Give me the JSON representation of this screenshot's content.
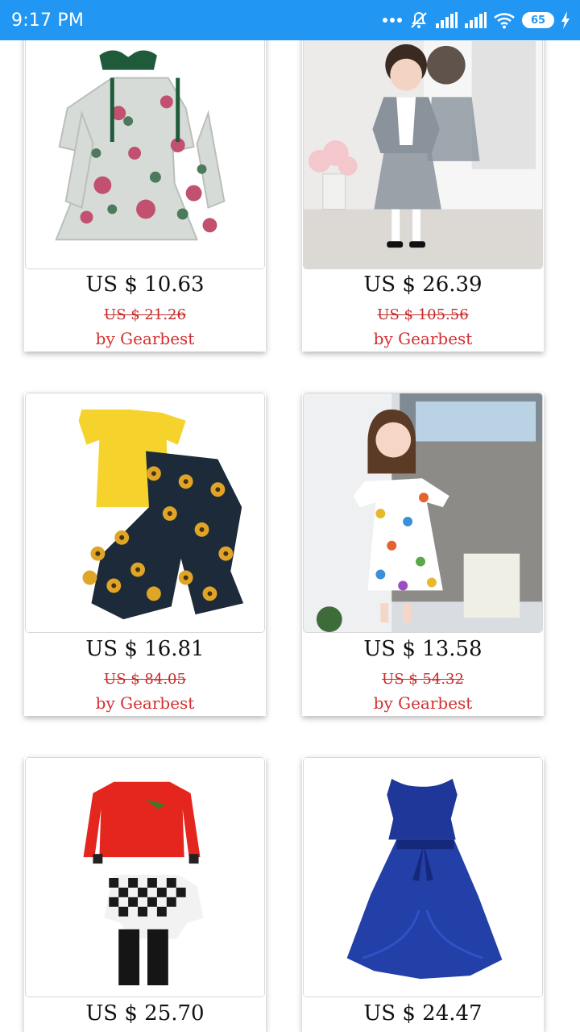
{
  "status_bar": {
    "time": "9:17 PM",
    "battery_level": "65",
    "icons": [
      "dots-icon",
      "dnd-off-icon",
      "signal-icon",
      "signal-icon",
      "wifi-icon",
      "battery-icon",
      "charging-icon"
    ]
  },
  "products": [
    {
      "price": "US $ 10.63",
      "old_price": "US $ 21.26",
      "seller": "by Gearbest",
      "image": "floral-dress-with-headband"
    },
    {
      "price": "US $ 26.39",
      "old_price": "US $ 105.56",
      "seller": "by Gearbest",
      "image": "girl-school-uniform"
    },
    {
      "price": "US $ 16.81",
      "old_price": "US $ 84.05",
      "seller": "by Gearbest",
      "image": "yellow-top-sunflower-pants"
    },
    {
      "price": "US $ 13.58",
      "old_price": "US $ 54.32",
      "seller": "by Gearbest",
      "image": "girl-printed-dress"
    },
    {
      "price": "US $ 25.70",
      "image": "red-sweater-plaid-set"
    },
    {
      "price": "US $ 24.47",
      "image": "navy-satin-dress"
    }
  ],
  "colors": {
    "status_bar": "#2196f3",
    "old_price": "#c62828",
    "seller": "#d32f2f"
  }
}
